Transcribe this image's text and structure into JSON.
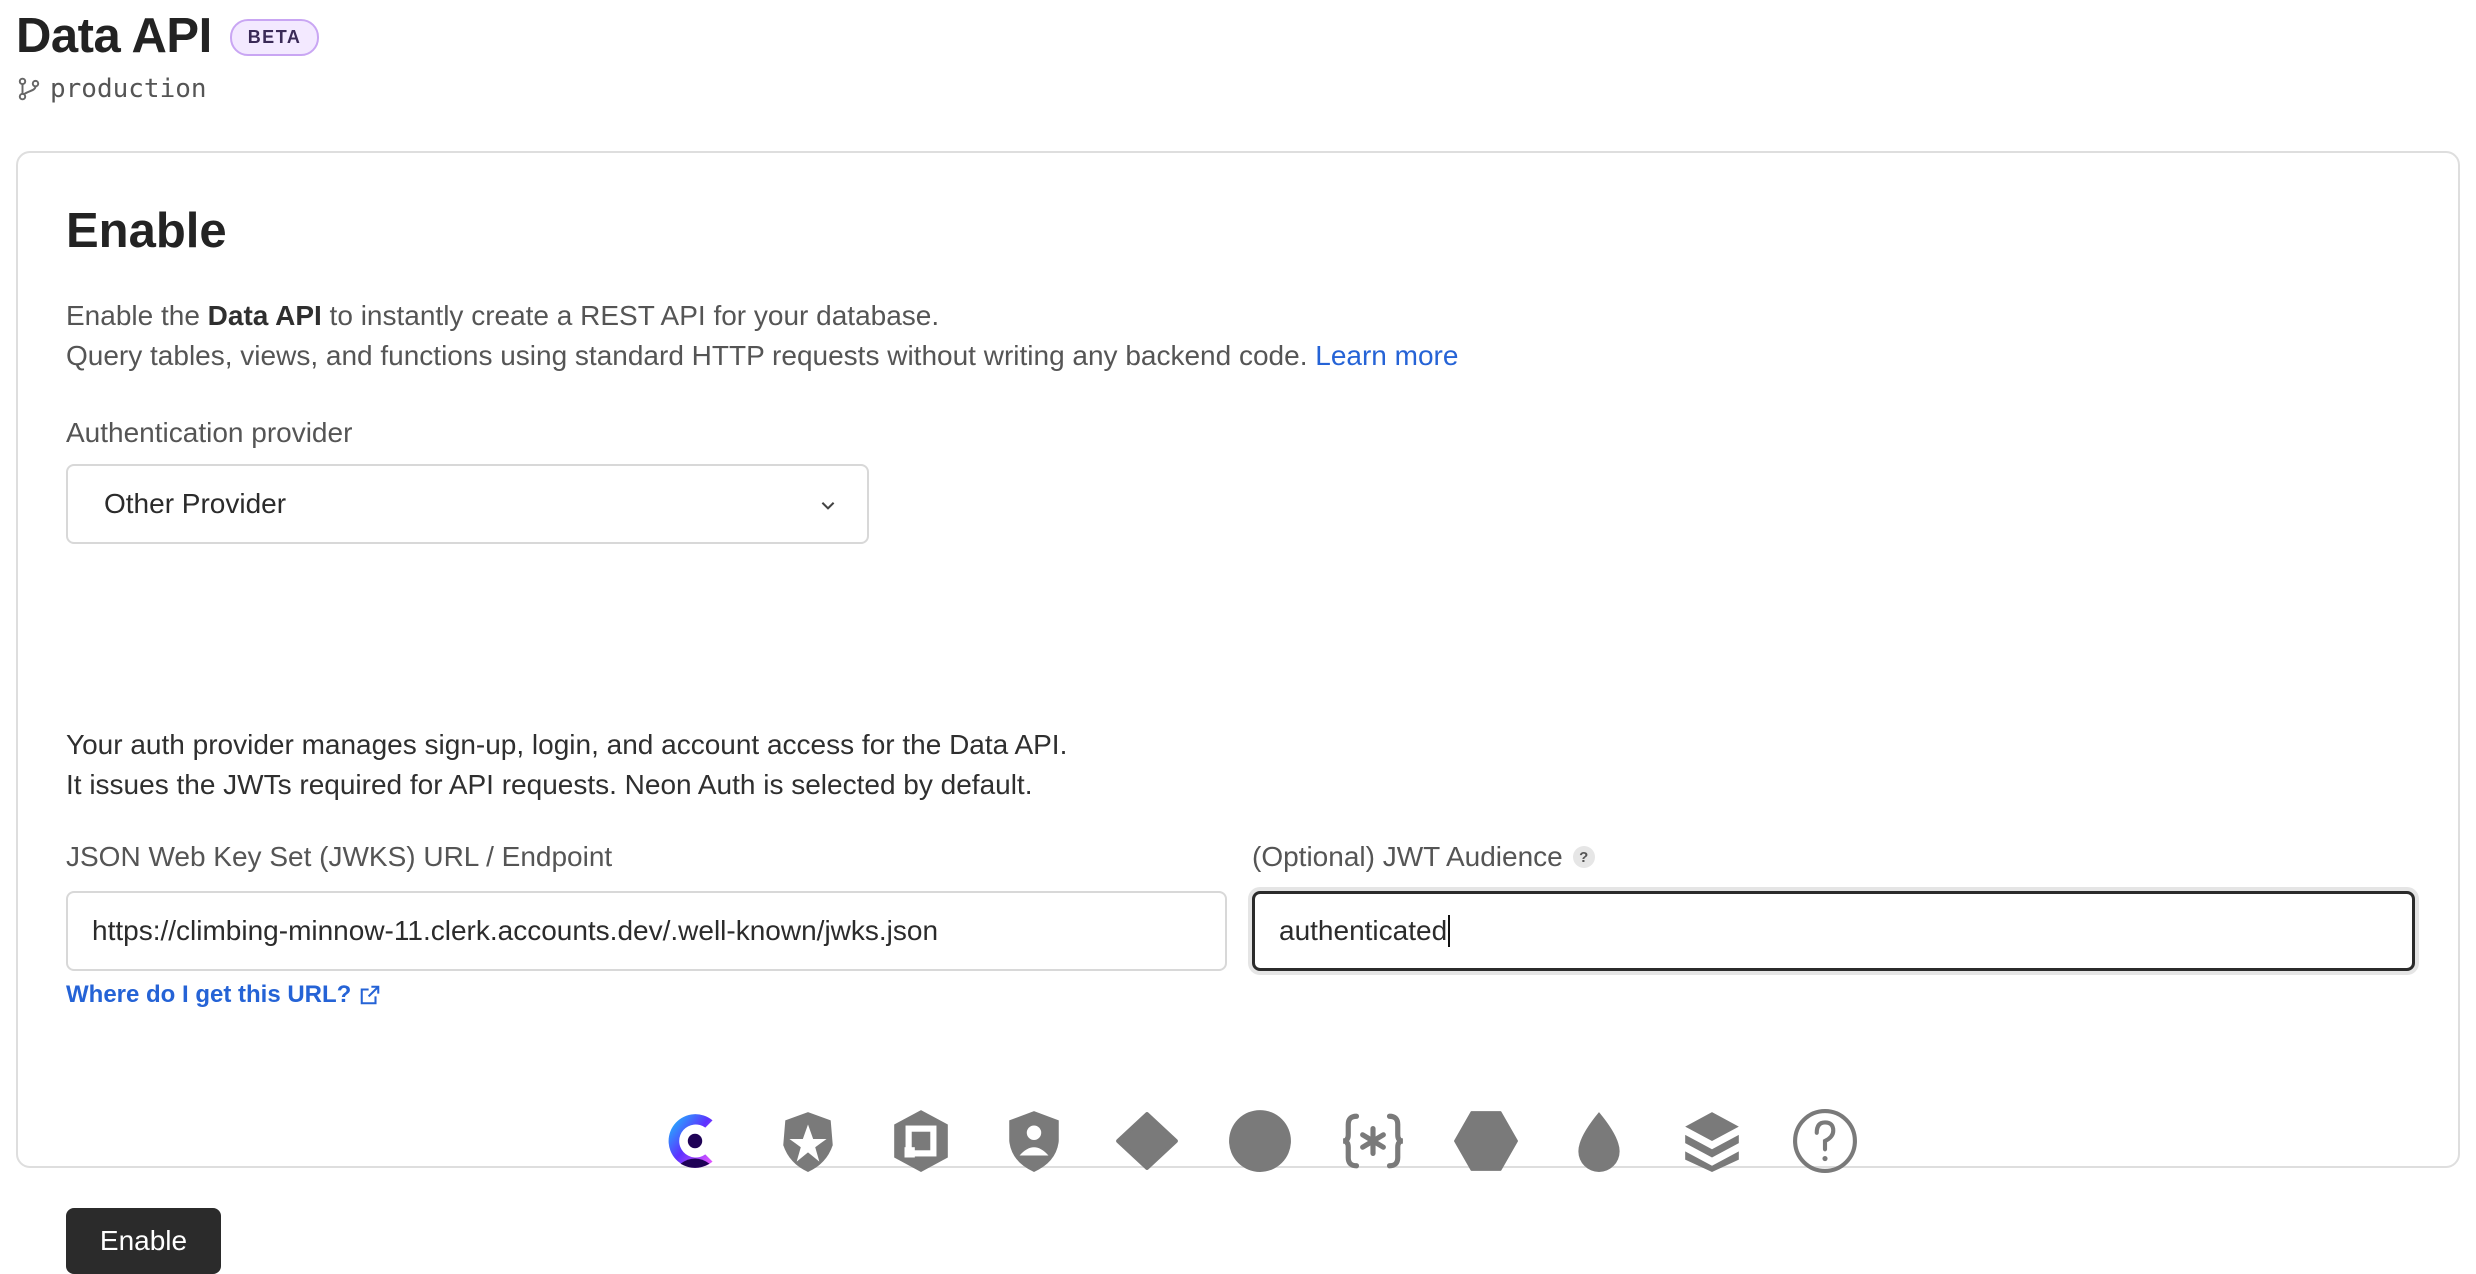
{
  "header": {
    "title": "Data API",
    "badge": "BETA",
    "branch": "production"
  },
  "card": {
    "title": "Enable",
    "description": {
      "line1_prefix": "Enable the ",
      "line1_bold": "Data API",
      "line1_suffix": " to instantly create a REST API for your database.",
      "line2": "Query tables, views, and functions using standard HTTP requests without writing any backend code. ",
      "learn_more": "Learn more"
    },
    "provider_label": "Authentication provider",
    "provider_value": "Other Provider",
    "auth_desc_line1": "Your auth provider manages sign-up, login, and account access for the Data API.",
    "auth_desc_line2": "It issues the JWTs required for API requests. Neon Auth is selected by default.",
    "jwks_label": "JSON Web Key Set (JWKS) URL / Endpoint",
    "jwks_value": "https://climbing-minnow-11.clerk.accounts.dev/.well-known/jwks.json",
    "audience_label": "(Optional) JWT Audience",
    "audience_help": "?",
    "audience_value": "authenticated",
    "where_link": "Where do I get this URL?",
    "enable_button": "Enable"
  },
  "providers": [
    "clerk-icon",
    "auth0-icon",
    "stytch-icon",
    "shield-user-icon",
    "diamond-icon",
    "circle-icon",
    "curly-asterisk-icon",
    "hexagon-icon",
    "drop-icon",
    "stack-icon",
    "question-circle-icon"
  ],
  "colors": {
    "link": "#2563d6",
    "badge_bg": "#f3e9ff",
    "badge_border": "#c9a6f3",
    "button_bg": "#2b2b2b",
    "provider_icon": "#7a7a7a",
    "clerk_gradient_start": "#6c47ff"
  }
}
